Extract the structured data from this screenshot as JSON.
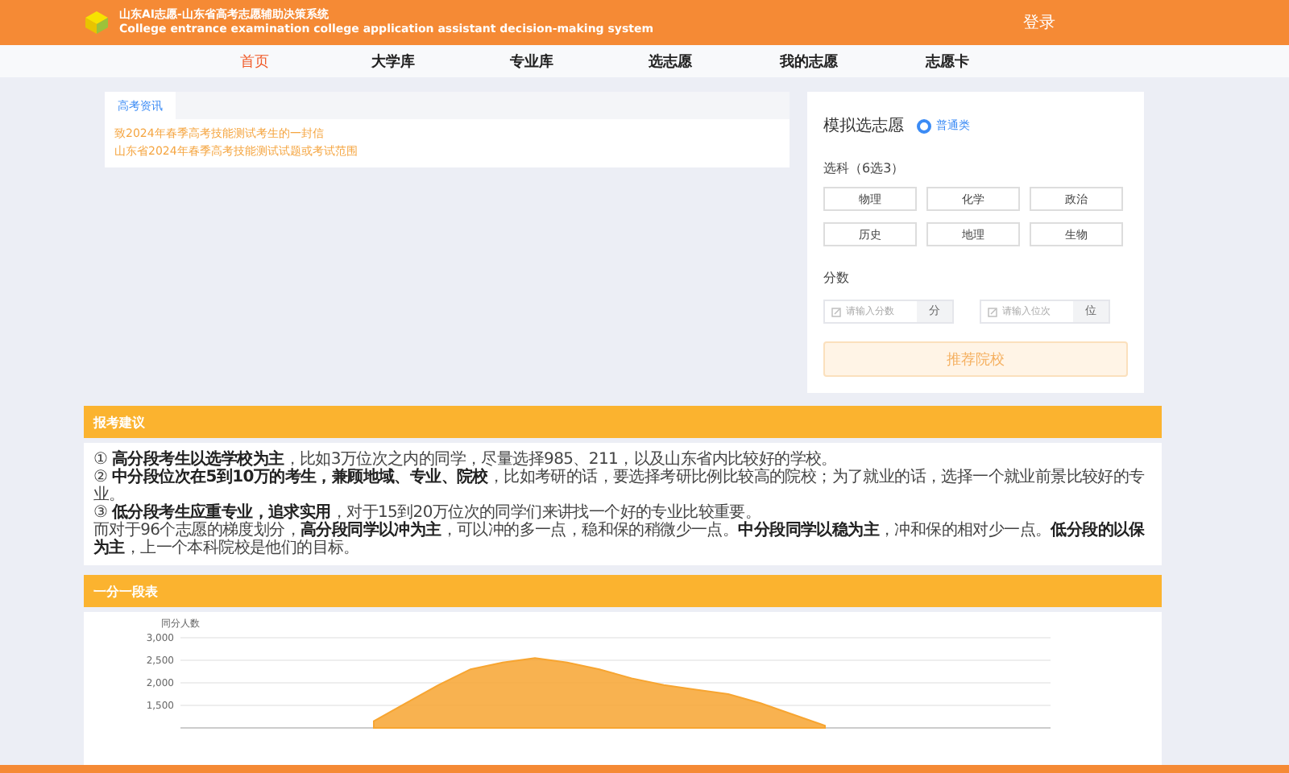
{
  "header": {
    "title": "山东AI志愿-山东省高考志愿辅助决策系统",
    "subtitle": "College entrance examination college application assistant decision-making system",
    "login": "登录"
  },
  "nav": [
    {
      "label": "首页",
      "selected": true
    },
    {
      "label": "大学库",
      "selected": false
    },
    {
      "label": "专业库",
      "selected": false
    },
    {
      "label": "选志愿",
      "selected": false
    },
    {
      "label": "我的志愿",
      "selected": false
    },
    {
      "label": "志愿卡",
      "selected": false
    }
  ],
  "news": {
    "tab": "高考资讯",
    "items": [
      "致2024年春季高考技能测试考生的一封信",
      "山东省2024年春季高考技能测试试题或考试范围"
    ]
  },
  "simulator": {
    "title": "模拟选志愿",
    "category": {
      "label": "普通类",
      "selected": true
    },
    "subjects_label": "选科（6选3）",
    "subjects": [
      {
        "label": "物理",
        "selected": false
      },
      {
        "label": "化学",
        "selected": false
      },
      {
        "label": "政治",
        "selected": false
      },
      {
        "label": "历史",
        "selected": false
      },
      {
        "label": "地理",
        "selected": false
      },
      {
        "label": "生物",
        "selected": false
      }
    ],
    "score_label": "分数",
    "inputs": [
      {
        "placeholder": "请输入分数",
        "unit": "分"
      },
      {
        "placeholder": "请输入位次",
        "unit": "位"
      }
    ],
    "button": "推荐院校"
  },
  "advice": {
    "title": "报考建议",
    "lines": [
      "① **高分段考生以选学校为主**，比如3万位次之内的同学，尽量选择985、211，以及山东省内比较好的学校。",
      "② **中分段位次在5到10万的考生，兼顾地域、专业、院校**，比如考研的话，要选择考研比例比较高的院校；为了就业的话，选择一个就业前景比较好的专业。",
      "③ **低分段考生应重专业，追求实用**，对于15到20万位次的同学们来讲找一个好的专业比较重要。",
      "而对于96个志愿的梯度划分，**高分段同学以冲为主**，可以冲的多一点，稳和保的稍微少一点。**中分段同学以稳为主**，冲和保的相对少一点。**低分段的以保为主**，上一个本科院校是他们的目标。"
    ]
  },
  "score_table": {
    "title": "一分一段表",
    "chart_data": {
      "type": "area",
      "ylabel": "同分人数",
      "grid": true,
      "ylim": [
        1000,
        3000
      ],
      "yticks": [
        {
          "value": 3000,
          "label": "3,000"
        },
        {
          "value": 2500,
          "label": "2,500"
        },
        {
          "value": 2000,
          "label": "2,000"
        },
        {
          "value": 1500,
          "label": "1,500"
        }
      ],
      "series": [
        {
          "color": "#f7a531",
          "values": [
            null,
            null,
            null,
            null,
            null,
            null,
            1150,
            1550,
            1950,
            2300,
            2450,
            2550,
            2450,
            2300,
            2100,
            1950,
            1850,
            1750,
            1550,
            1300,
            1050,
            null,
            null,
            null,
            null,
            null,
            null,
            null
          ]
        }
      ]
    }
  }
}
